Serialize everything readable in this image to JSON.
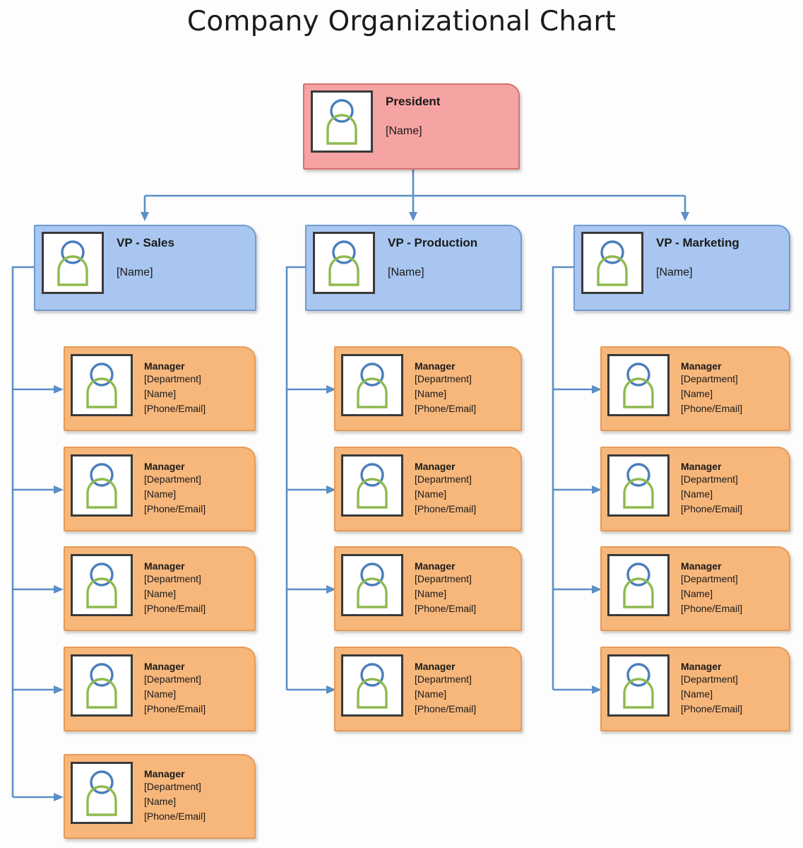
{
  "page": {
    "title": "Company Organizational Chart",
    "background": "#fdfdfd"
  },
  "colors": {
    "president_fill": "#f6a3a3",
    "president_border": "#d86f6f",
    "vp_fill": "#a8c6ef",
    "vp_border": "#6f9bd1",
    "manager_fill": "#f7b77b",
    "manager_border": "#e89a55",
    "connector": "#5b8fc7",
    "icon_head": "#4a7ebb",
    "icon_body": "#8fb94f",
    "photo_frame": "#3a3a3a",
    "text": "#1a1a1a"
  },
  "icons": {
    "person": "person-avatar-icon"
  },
  "chart_data": {
    "type": "diagram",
    "diagram_type": "organizational-chart",
    "title": "Company Organizational Chart",
    "orientation": "top-down with left-attached subordinate branches",
    "levels": 3,
    "node_counts": {
      "president": 1,
      "vice_presidents": 3,
      "managers": 13
    },
    "nodes": [
      {
        "id": "president",
        "level": 1,
        "role": "President",
        "lines": [
          "President",
          "[Name]"
        ],
        "fill": "#f6a3a3",
        "children": [
          "vp-sales",
          "vp-production",
          "vp-marketing"
        ]
      },
      {
        "id": "vp-sales",
        "level": 2,
        "role": "VP - Sales",
        "lines": [
          "VP - Sales",
          "[Name]"
        ],
        "fill": "#a8c6ef",
        "manager_count": 5
      },
      {
        "id": "vp-production",
        "level": 2,
        "role": "VP - Production",
        "lines": [
          "VP - Production",
          "[Name]"
        ],
        "fill": "#a8c6ef",
        "manager_count": 4
      },
      {
        "id": "vp-marketing",
        "level": 2,
        "role": "VP - Marketing",
        "lines": [
          "VP - Marketing",
          "[Name]"
        ],
        "fill": "#a8c6ef",
        "manager_count": 4
      }
    ],
    "manager_template": [
      "Manager",
      "[Department]",
      "[Name]",
      "[Phone/Email]"
    ]
  },
  "president": {
    "role": "President",
    "name": "[Name]"
  },
  "columns": [
    {
      "key": "sales",
      "vp": {
        "role": "VP - Sales",
        "name": "[Name]"
      },
      "managers": [
        {
          "role": "Manager",
          "department": "[Department]",
          "name": "[Name]",
          "contact": "[Phone/Email]"
        },
        {
          "role": "Manager",
          "department": "[Department]",
          "name": "[Name]",
          "contact": "[Phone/Email]"
        },
        {
          "role": "Manager",
          "department": "[Department]",
          "name": "[Name]",
          "contact": "[Phone/Email]"
        },
        {
          "role": "Manager",
          "department": "[Department]",
          "name": "[Name]",
          "contact": "[Phone/Email]"
        },
        {
          "role": "Manager",
          "department": "[Department]",
          "name": "[Name]",
          "contact": "[Phone/Email]"
        }
      ]
    },
    {
      "key": "production",
      "vp": {
        "role": "VP - Production",
        "name": "[Name]"
      },
      "managers": [
        {
          "role": "Manager",
          "department": "[Department]",
          "name": "[Name]",
          "contact": "[Phone/Email]"
        },
        {
          "role": "Manager",
          "department": "[Department]",
          "name": "[Name]",
          "contact": "[Phone/Email]"
        },
        {
          "role": "Manager",
          "department": "[Department]",
          "name": "[Name]",
          "contact": "[Phone/Email]"
        },
        {
          "role": "Manager",
          "department": "[Department]",
          "name": "[Name]",
          "contact": "[Phone/Email]"
        }
      ]
    },
    {
      "key": "marketing",
      "vp": {
        "role": "VP - Marketing",
        "name": "[Name]"
      },
      "managers": [
        {
          "role": "Manager",
          "department": "[Department]",
          "name": "[Name]",
          "contact": "[Phone/Email]"
        },
        {
          "role": "Manager",
          "department": "[Department]",
          "name": "[Name]",
          "contact": "[Phone/Email]"
        },
        {
          "role": "Manager",
          "department": "[Department]",
          "name": "[Name]",
          "contact": "[Phone/Email]"
        },
        {
          "role": "Manager",
          "department": "[Department]",
          "name": "[Name]",
          "contact": "[Phone/Email]"
        }
      ]
    }
  ]
}
